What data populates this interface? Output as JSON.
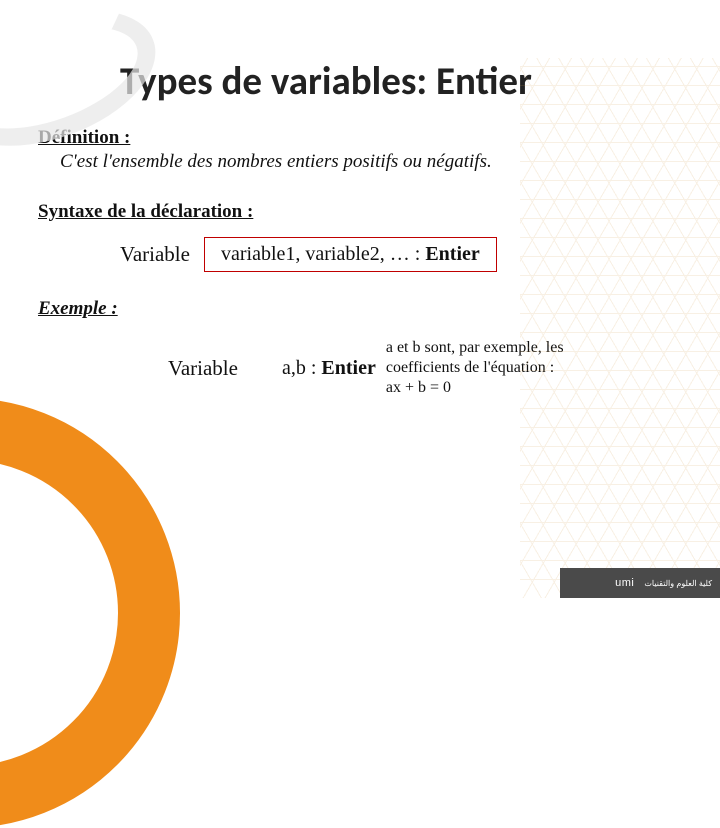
{
  "title": "Types de variables: Entier",
  "definition": {
    "heading": "Définition :",
    "text": "C'est l'ensemble des nombres entiers positifs ou négatifs."
  },
  "syntax": {
    "heading": "Syntaxe de la déclaration :",
    "keyword": "Variable",
    "vars": "variable1, variable2, …  : ",
    "type": "Entier"
  },
  "example": {
    "heading": "Exemple :",
    "keyword": "Variable",
    "decl_vars": "a,b  : ",
    "decl_type": "Entier",
    "note": "a et b sont, par exemple, les coefficients de l'équation :  ax + b = 0"
  },
  "footer": {
    "logo1": "umi",
    "logo2": "كلية العلوم والتقنيات"
  }
}
